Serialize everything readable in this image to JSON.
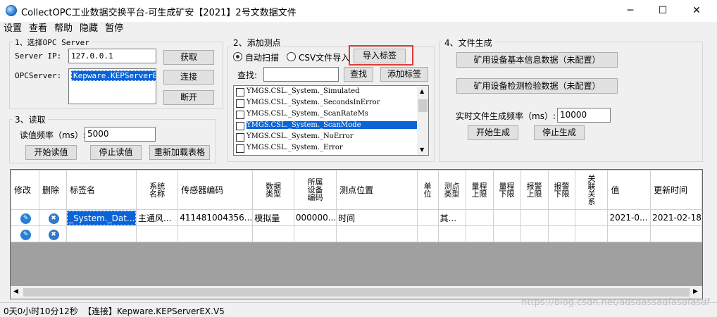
{
  "window": {
    "title": "CollectOPC工业数据交换平台-可生成矿安【2021】2号文数据文件",
    "minimize": "─",
    "maximize": "☐",
    "close": "✕"
  },
  "menu": [
    "设置",
    "查看",
    "帮助",
    "隐藏",
    "暂停"
  ],
  "section1": {
    "title": "1、选择OPC Server",
    "server_ip_label": "Server IP:",
    "server_ip_value": "127.0.0.1",
    "opcserver_label": "OPCServer:",
    "opcserver_selected": "Kepware.KEPServerEX",
    "get_button": "获取",
    "connect_button": "连接",
    "disconnect_button": "断开"
  },
  "section2": {
    "title": "2、添加测点",
    "radio_auto": "自动扫描",
    "radio_csv": "CSV文件导入",
    "import_button": "导入标签",
    "search_label": "查找:",
    "search_value": "",
    "search_button": "查找",
    "add_button": "添加标签",
    "tags": [
      "YMGS.CSL._System._Simulated",
      "YMGS.CSL._System._SecondsInError",
      "YMGS.CSL._System._ScanRateMs",
      "YMGS.CSL._System._ScanMode",
      "YMGS.CSL._System._NoError",
      "YMGS.CSL._System._Error"
    ]
  },
  "section3": {
    "title": "3、读取",
    "freq_label": "读值频率（ms）:",
    "freq_value": "5000",
    "start_button": "开始读值",
    "stop_button": "停止读值",
    "reload_button": "重新加载表格"
  },
  "section4": {
    "title": "4、文件生成",
    "basic_button": "矿用设备基本信息数据（未配置）",
    "inspect_button": "矿用设备检测检验数据（未配置）",
    "freq_label": "实时文件生成频率（ms）:",
    "freq_value": "10000",
    "start_button": "开始生成",
    "stop_button": "停止生成"
  },
  "grid": {
    "headers": [
      "修改",
      "删除",
      "标签名",
      "系统名称",
      "传感器编码",
      "数据类型",
      "所属设备编码",
      "测点位置",
      "单位",
      "测点类型",
      "量程上限",
      "量程下限",
      "报警上限",
      "报警下限",
      "关联关系",
      "值",
      "更新时间"
    ],
    "row1": [
      "",
      "",
      "_System._Dat...",
      "主通风...",
      "411481004356...",
      "模拟量",
      "000000...",
      "时间",
      "",
      "其...",
      "",
      "",
      "",
      "",
      "",
      "2021-0...",
      "2021-02-18"
    ]
  },
  "status": {
    "uptime": "0天0小时10分12秒",
    "connection": "【连接】Kepware.KEPServerEX.V5"
  },
  "watermark": "https://blog.csdn.net/adsdassadfasdfasdf",
  "colors": {
    "selection": "#0a64d8",
    "highlight_border": "#e53935"
  }
}
